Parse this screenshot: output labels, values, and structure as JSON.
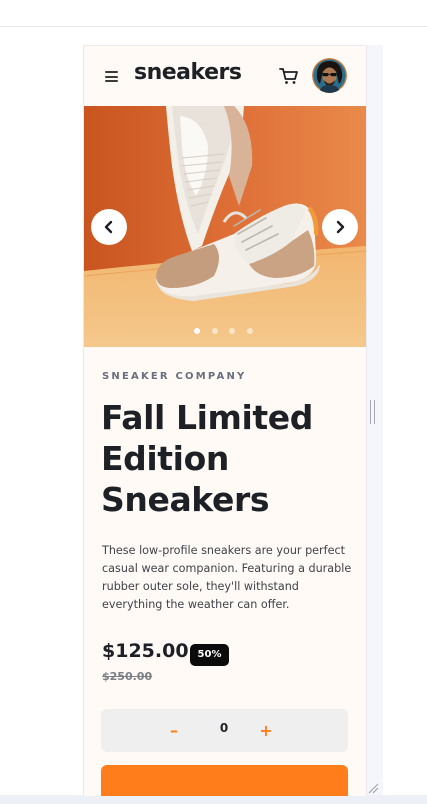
{
  "header": {
    "logo": "sneakers",
    "menu_icon": "menu-icon",
    "cart_icon": "cart-icon",
    "avatar_alt": "user avatar"
  },
  "gallery": {
    "prev_icon": "chevron-left-icon",
    "next_icon": "chevron-right-icon",
    "slides": 4,
    "active_slide": 1
  },
  "product": {
    "company": "SNEAKER COMPANY",
    "title_line1": "Fall Limited",
    "title_line2": "Edition",
    "title_line3": "Sneakers",
    "description": "These low-profile sneakers are your perfect casual wear companion. Featuring a durable rubber outer sole, they'll withstand everything the weather can offer.",
    "price": "$125.00",
    "discount": "50%",
    "old_price": "$250.00"
  },
  "quantity": {
    "minus": "–",
    "value": "0",
    "plus": "+"
  },
  "colors": {
    "accent": "#ff7d1a",
    "dark": "#1d2025",
    "gallery_bg": "#e4763b"
  }
}
